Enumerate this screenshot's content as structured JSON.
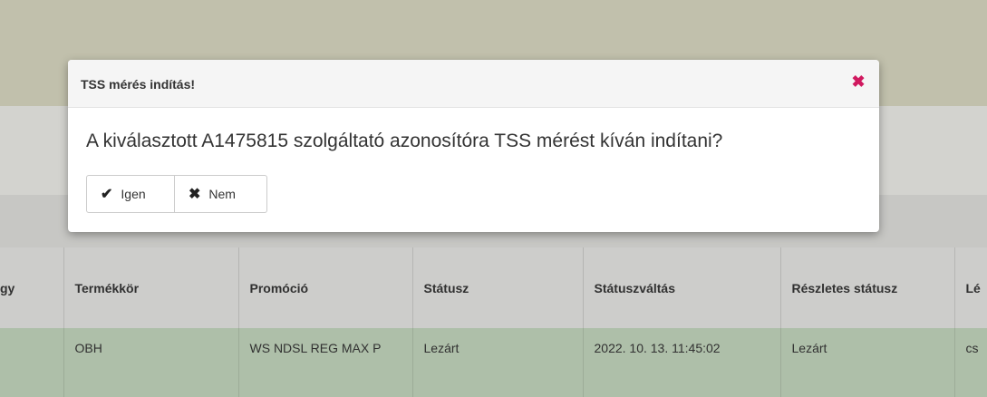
{
  "dialog": {
    "title": "TSS mérés indítás!",
    "close_icon": "close-icon",
    "message": "A kiválasztott A1475815 szolgáltató azonosítóra TSS mérést kíván indítani?",
    "yes_label": "Igen",
    "no_label": "Nem",
    "accent_color": "#d0195f"
  },
  "table": {
    "headers": [
      "gy",
      "Termékkör",
      "Promóció",
      "Státusz",
      "Státuszváltás",
      "Részletes státusz",
      "Lé"
    ],
    "rows": [
      [
        "",
        "OBH",
        "WS NDSL REG MAX P",
        "Lezárt",
        "2022. 10. 13. 11:45:02",
        "Lezárt",
        "cs"
      ]
    ]
  }
}
